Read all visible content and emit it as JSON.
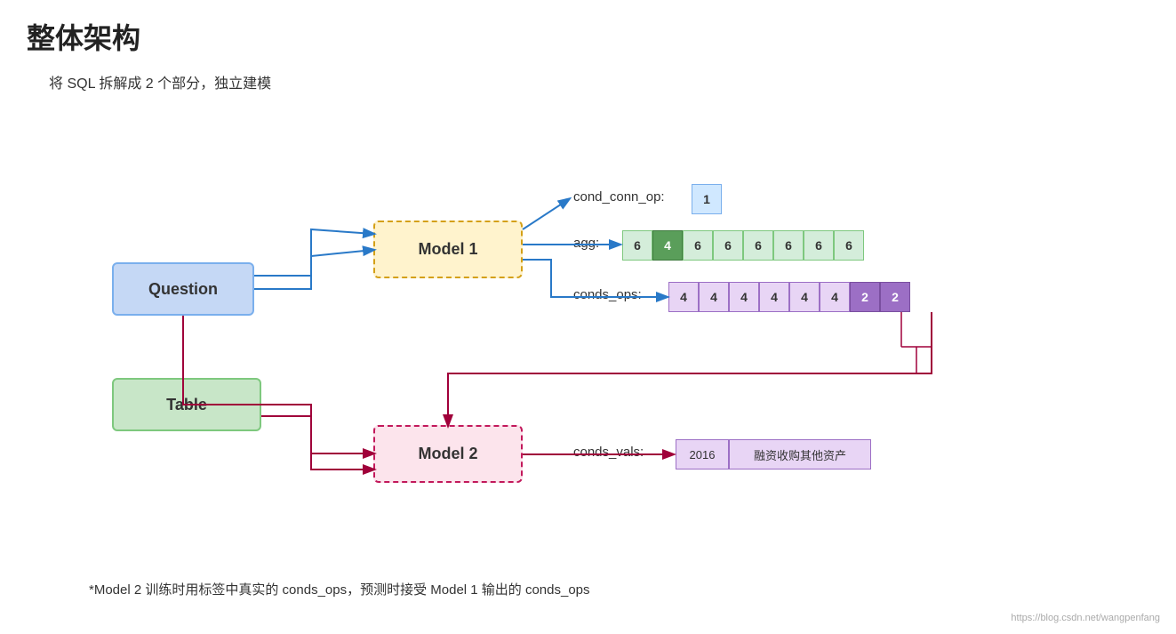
{
  "page": {
    "title": "整体架构",
    "subtitle": "将 SQL 拆解成 2 个部分，独立建模",
    "footnote": "*Model 2 训练时用标签中真实的 conds_ops，预测时接受 Model 1 输出的 conds_ops",
    "watermark": "https://blog.csdn.net/wangpenfang"
  },
  "boxes": {
    "question": "Question",
    "table": "Table",
    "model1": "Model 1",
    "model2": "Model 2"
  },
  "outputs": {
    "cond_conn_op_label": "cond_conn_op:",
    "cond_conn_op_value": "1",
    "agg_label": "agg:",
    "agg_values": [
      "6",
      "4",
      "6",
      "6",
      "6",
      "6",
      "6",
      "6"
    ],
    "conds_ops_label": "conds_ops:",
    "conds_ops_values": [
      "4",
      "4",
      "4",
      "4",
      "4",
      "4",
      "2",
      "2"
    ],
    "conds_vals_label": "conds_vals:",
    "conds_vals": [
      "2016",
      "融资收购其他资产"
    ]
  }
}
